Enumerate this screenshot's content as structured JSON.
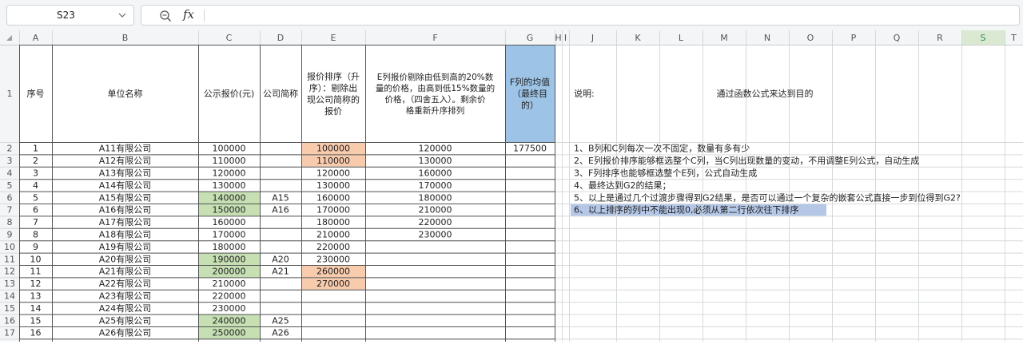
{
  "name_box": {
    "value": "S23"
  },
  "formula_bar": {
    "fx_label": "fx",
    "value": ""
  },
  "columns": [
    "A",
    "B",
    "C",
    "D",
    "E",
    "F",
    "G",
    "H",
    "I",
    "J",
    "K",
    "L",
    "M",
    "N",
    "O",
    "P",
    "Q",
    "R",
    "S",
    "T"
  ],
  "row_numbers": [
    "1",
    "2",
    "3",
    "4",
    "5",
    "6",
    "7",
    "8",
    "9",
    "10",
    "11",
    "12",
    "13",
    "14",
    "15",
    "16",
    "17"
  ],
  "selected_column": "S",
  "headers": {
    "A": "序号",
    "B": "单位名称",
    "C": "公示报价(元)",
    "D": "公司简称",
    "E": [
      "报价排序（升",
      "序）：剔除出",
      "现公司简称的",
      "报价"
    ],
    "F": [
      "E列报价剔除由低到高的20%数",
      "量的价格，由高到低15%数量的",
      "价格，（四舍五入）。剩余价",
      "格重新升序排列"
    ],
    "G": [
      "F列的均值",
      "（最终目",
      "的）"
    ],
    "J": "说明:",
    "L": "通过函数公式来达到目的"
  },
  "rows": [
    {
      "n": "1",
      "name": "A11有限公司",
      "price": "100000",
      "abbr": "",
      "e": "100000",
      "f": "120000",
      "g": "177500"
    },
    {
      "n": "2",
      "name": "A12有限公司",
      "price": "110000",
      "abbr": "",
      "e": "110000",
      "f": "130000",
      "g": ""
    },
    {
      "n": "3",
      "name": "A13有限公司",
      "price": "120000",
      "abbr": "",
      "e": "120000",
      "f": "160000",
      "g": ""
    },
    {
      "n": "4",
      "name": "A14有限公司",
      "price": "130000",
      "abbr": "",
      "e": "130000",
      "f": "170000",
      "g": ""
    },
    {
      "n": "5",
      "name": "A15有限公司",
      "price": "140000",
      "abbr": "A15",
      "e": "160000",
      "f": "180000",
      "g": ""
    },
    {
      "n": "6",
      "name": "A16有限公司",
      "price": "150000",
      "abbr": "A16",
      "e": "170000",
      "f": "210000",
      "g": ""
    },
    {
      "n": "7",
      "name": "A17有限公司",
      "price": "160000",
      "abbr": "",
      "e": "180000",
      "f": "220000",
      "g": ""
    },
    {
      "n": "8",
      "name": "A18有限公司",
      "price": "170000",
      "abbr": "",
      "e": "210000",
      "f": "230000",
      "g": ""
    },
    {
      "n": "9",
      "name": "A19有限公司",
      "price": "180000",
      "abbr": "",
      "e": "220000",
      "f": "",
      "g": ""
    },
    {
      "n": "10",
      "name": "A20有限公司",
      "price": "190000",
      "abbr": "A20",
      "e": "230000",
      "f": "",
      "g": ""
    },
    {
      "n": "11",
      "name": "A21有限公司",
      "price": "200000",
      "abbr": "A21",
      "e": "260000",
      "f": "",
      "g": ""
    },
    {
      "n": "12",
      "name": "A22有限公司",
      "price": "210000",
      "abbr": "",
      "e": "270000",
      "f": "",
      "g": ""
    },
    {
      "n": "13",
      "name": "A23有限公司",
      "price": "220000",
      "abbr": "",
      "e": "",
      "f": "",
      "g": ""
    },
    {
      "n": "14",
      "name": "A24有限公司",
      "price": "230000",
      "abbr": "",
      "e": "",
      "f": "",
      "g": ""
    },
    {
      "n": "15",
      "name": "A25有限公司",
      "price": "240000",
      "abbr": "A25",
      "e": "",
      "f": "",
      "g": ""
    },
    {
      "n": "16",
      "name": "A26有限公司",
      "price": "250000",
      "abbr": "A26",
      "e": "",
      "f": "",
      "g": ""
    }
  ],
  "notes": [
    "1、B列和C列每次一次不固定，数量有多有少",
    "2、E列报价排序能够框选整个C列，当C列出现数量的变动，不用调整E列公式，自动生成",
    "3、F列排序也能够框选整个E列，公式自动生成",
    "4、最终达到G2的结果；",
    "5、以上是通过几个过渡步骤得到G2结果，是否可以通过一个复杂的嵌套公式直接一步到位得到G2?",
    "6、以上排序的列中不能出现0,必须从第二行依次往下排序"
  ],
  "highlighted_note_index": 5,
  "colors": {
    "green_fill": "#c6e0b4",
    "orange_fill": "#f8cbad",
    "blue_fill": "#9dc3e6",
    "note_highlight": "#b4c7e7",
    "header_bg": "#f3f5f7",
    "selected_header_bg": "#dbe9d3",
    "selected_header_text": "#2f8a4c"
  },
  "green_rows_C": [
    5,
    6,
    10,
    11,
    15,
    16
  ],
  "orange_rows_E": [
    1,
    2,
    11,
    12
  ]
}
